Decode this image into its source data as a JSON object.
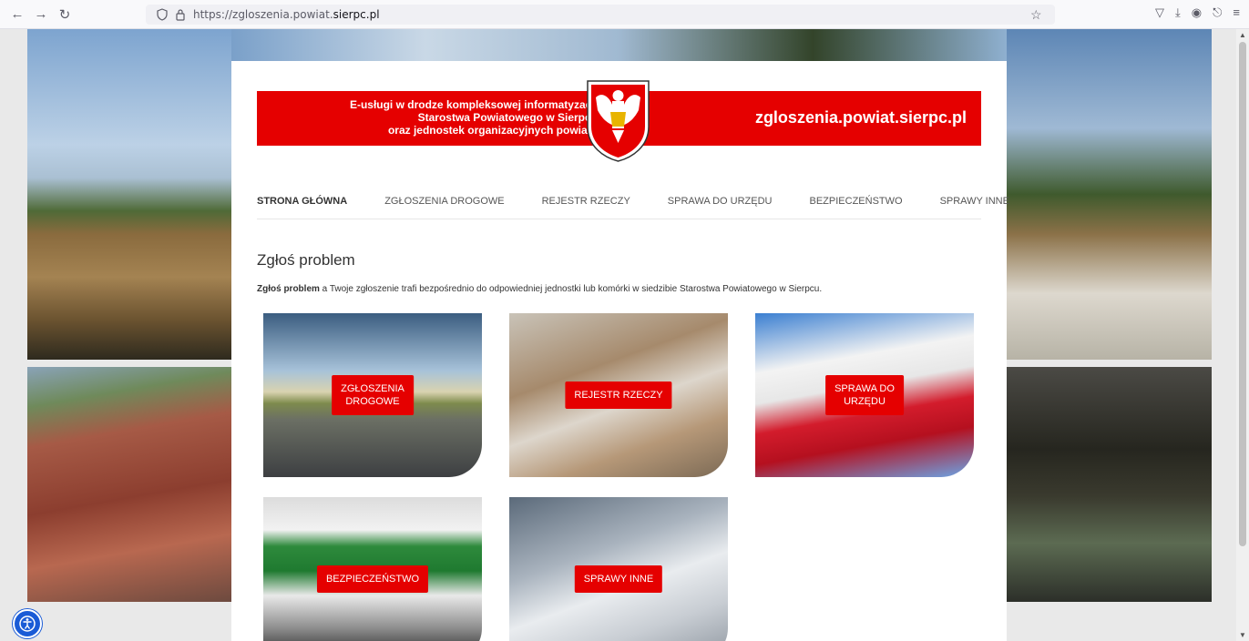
{
  "browser": {
    "url_prefix": "https://zgloszenia.powiat.",
    "url_host": "sierpc.pl",
    "icons": [
      "back-icon",
      "forward-icon",
      "reload-icon",
      "shield-icon",
      "lock-icon",
      "bookmark-star-icon",
      "pocket-icon",
      "download-icon",
      "account-icon",
      "extensions-icon",
      "menu-icon"
    ]
  },
  "banner": {
    "line1": "E-usługi w drodze kompleksowej informatyzacji",
    "line2": "Starostwa Powiatowego w Sierpcu",
    "line3": "oraz jednostek organizacyjnych powiatu",
    "site": "zgloszenia.powiat.sierpc.pl",
    "color": "#e50000"
  },
  "menu": [
    {
      "label": "STRONA GŁÓWNA",
      "active": true
    },
    {
      "label": "ZGŁOSZENIA DROGOWE"
    },
    {
      "label": "REJESTR RZECZY"
    },
    {
      "label": "SPRAWA DO URZĘDU"
    },
    {
      "label": "BEZPIECZEŃSTWO"
    },
    {
      "label": "SPRAWY INNE"
    }
  ],
  "main": {
    "heading": "Zgłoś problem",
    "intro_bold": "Zgłoś problem",
    "intro_rest": " a Twoje zgłoszenie trafi bezpośrednio do odpowiedniej jednostki lub komórki w siedzibie Starostwa Powiatowego w Sierpcu."
  },
  "tiles": [
    {
      "line1": "ZGŁOSZENIA",
      "line2": "DROGOWE"
    },
    {
      "line1": "REJESTR RZECZY"
    },
    {
      "line1": "SPRAWA DO",
      "line2": "URZĘDU"
    },
    {
      "line1": "BEZPIECZEŃSTWO"
    },
    {
      "line1": "SPRAWY INNE"
    }
  ]
}
